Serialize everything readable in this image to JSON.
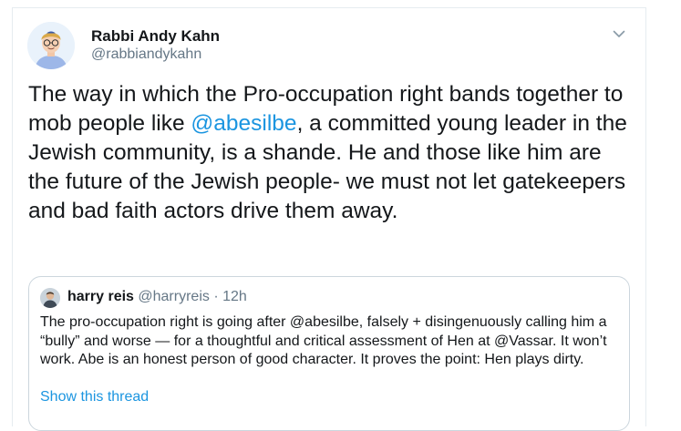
{
  "author": {
    "display_name": "Rabbi Andy Kahn",
    "handle": "@rabbiandykahn"
  },
  "tweet": {
    "text_part1": "The way in which the Pro-occupation right bands together to mob people like ",
    "mention": "@abesilbe",
    "text_part2": ", a committed young leader in the Jewish community, is a shande. He and those like him are the future of the Jewish people- we must not let gatekeepers and bad faith actors drive them away."
  },
  "icons": {
    "menu": "chevron-down-icon",
    "avatar": "avatar-icon"
  },
  "quoted_tweet": {
    "display_name": "harry reis",
    "handle": "@harryreis",
    "separator": "·",
    "timestamp": "12h",
    "text": "The pro-occupation right is going after @abesilbe, falsely + disingenuously calling him a “bully” and worse — for a thoughtful and critical assessment of Hen at @Vassar. It won’t work. Abe is an honest person of good character. It proves the point: Hen plays dirty.",
    "show_thread_label": "Show this thread"
  },
  "colors": {
    "link": "#1b95e0",
    "secondary_text": "#657786",
    "primary_text": "#14171a",
    "border": "#ccd6dd"
  }
}
